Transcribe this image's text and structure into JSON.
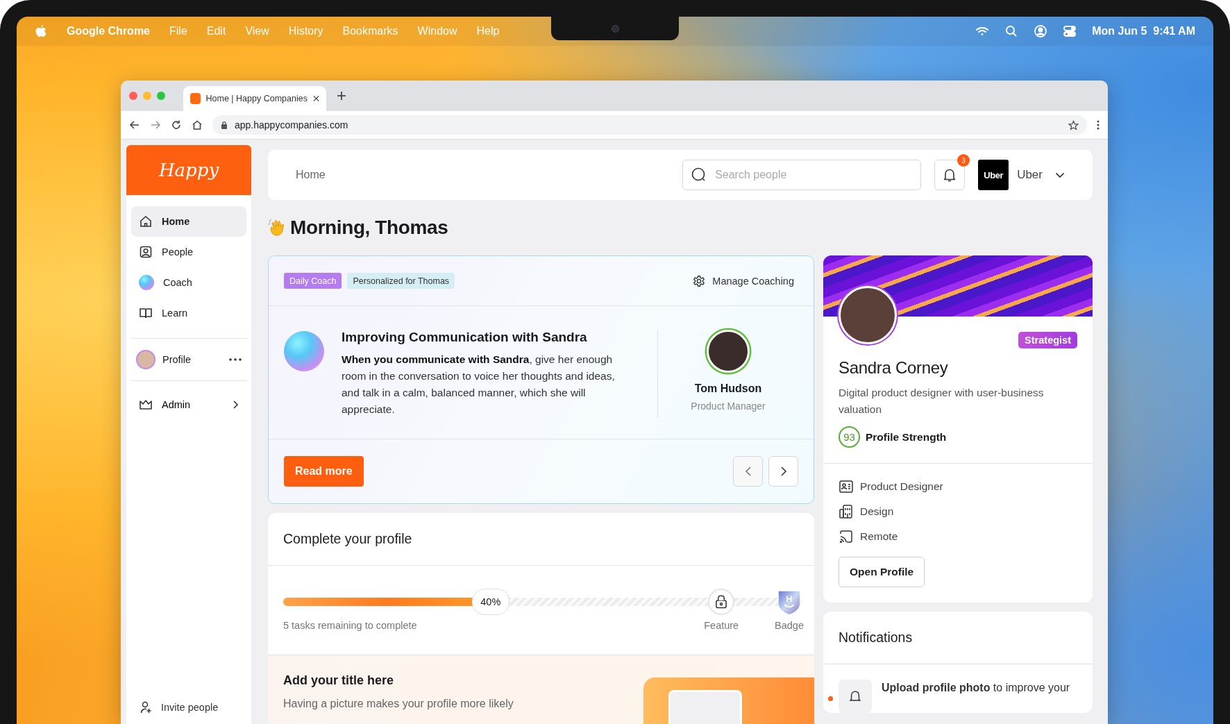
{
  "menubar": {
    "app": "Google Chrome",
    "menus": [
      "File",
      "Edit",
      "View",
      "History",
      "Bookmarks",
      "Window",
      "Help"
    ],
    "clock": "Mon Jun 5  9:41 AM"
  },
  "browser": {
    "tabs": [
      {
        "title": "Home | Happy Companies",
        "selected": true
      }
    ],
    "url": "app.happycompanies.com"
  },
  "sidebar": {
    "logo": "Happy",
    "nav": [
      {
        "label": "Home",
        "kind": "home",
        "selected": true
      },
      {
        "label": "People",
        "kind": "person",
        "selected": false
      },
      {
        "label": "Coach",
        "kind": "orb",
        "selected": false
      },
      {
        "label": "Learn",
        "kind": "book",
        "selected": false
      }
    ],
    "profile": "Profile",
    "admin": "Admin",
    "invite": "Invite people"
  },
  "topbar": {
    "breadcrumb": "Home",
    "search_placeholder": "Search people",
    "notification_count": "3",
    "company_logo": "Uber",
    "company": "Uber"
  },
  "greeting": "Morning, Thomas",
  "coach": {
    "tags": [
      {
        "label": "Daily Coach",
        "kind": "primary"
      },
      {
        "label": "Personalized for Thomas",
        "kind": "secondary"
      }
    ],
    "manage": "Manage Coaching",
    "title": "Improving Communication with Sandra",
    "body": "**When you communicate with Sandra**, give her enough room in the conversation to voice her thoughts and ideas, and talk in a calm, balanced manner, which she will appreciate.",
    "person": {
      "name": "Tom Hudson",
      "role": "Product Manager"
    },
    "cta": "Read more"
  },
  "profile_progress": {
    "title": "Complete your profile",
    "level": 0.4,
    "percent": "40%",
    "remaining": "5 tasks remaining to complete",
    "milestones": [
      {
        "label": "Feature",
        "kind": "lock"
      },
      {
        "label": "Badge",
        "kind": "badge"
      }
    ]
  },
  "add_title": {
    "title": "Add your title here",
    "text": "Having a picture makes your profile more likely"
  },
  "person_card": {
    "role_tag": "Strategist",
    "name": "Sandra Corney",
    "bio": "Digital product designer with user-business valuation",
    "strength": "93",
    "strength_label": "Profile Strength",
    "details": [
      {
        "kind": "role",
        "text": "Product Designer"
      },
      {
        "kind": "department",
        "text": "Design"
      },
      {
        "kind": "location",
        "text": "Remote"
      }
    ],
    "button": "Open Profile"
  },
  "notifications": {
    "title": "Notifications",
    "items": [
      {
        "text": "**Upload profile photo** to improve your",
        "unread": true
      }
    ]
  }
}
